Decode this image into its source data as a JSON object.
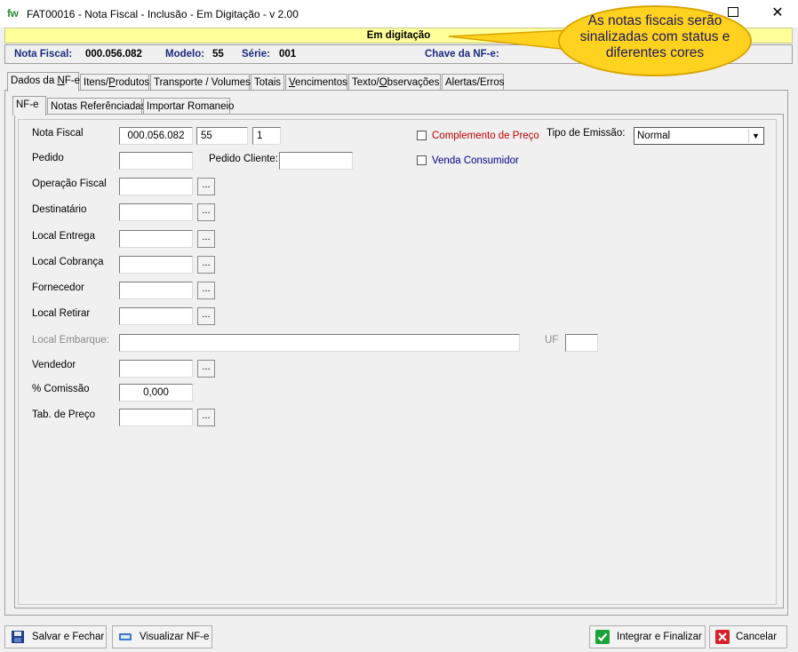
{
  "window": {
    "logo": "fw",
    "title": "FAT00016 - Nota Fiscal - Inclusão - Em Digitação - v 2.00",
    "close_glyph": "✕"
  },
  "status": {
    "text": "Em digitação",
    "color": "#ffff99"
  },
  "callout": {
    "text": "As notas fiscais serão sinalizadas com status e diferentes cores",
    "color": "#ffd21f"
  },
  "infobar": {
    "nota_label": "Nota Fiscal:",
    "nota_value": "000.056.082",
    "modelo_label": "Modelo:",
    "modelo_value": "55",
    "serie_label": "Série:",
    "serie_value": "001",
    "chave_label": "Chave da NF-e:"
  },
  "tabs": [
    "Dados da NF-e",
    "Itens/Produtos",
    "Transporte / Volumes",
    "Totais",
    "Vencimentos",
    "Texto/Observações",
    "Alertas/Erros"
  ],
  "subtabs": [
    "NF-e",
    "Notas Referênciadas",
    "Importar Romaneio"
  ],
  "form": {
    "nota_fiscal_label": "Nota Fiscal",
    "nota_fiscal_number": "000.056.082",
    "nota_fiscal_modelo": "55",
    "nota_fiscal_serie": "1",
    "pedido_label": "Pedido",
    "pedido_cliente_label": "Pedido Cliente:",
    "operacao_fiscal_label": "Operação Fiscal",
    "destinatario_label": "Destinatário",
    "local_entrega_label": "Local Entrega",
    "local_cobranca_label": "Local Cobrança",
    "fornecedor_label": "Fornecedor",
    "local_retirar_label": "Local Retirar",
    "local_embarque_label": "Local Embarque:",
    "uf_label": "UF",
    "vendedor_label": "Vendedor",
    "comissao_label": "% Comissão",
    "comissao_value": "0,000",
    "tab_preco_label": "Tab. de Preço",
    "lookup_glyph": "...",
    "complemento_preco_label": "Complemento de Preço",
    "complemento_preco_color": "#c00000",
    "venda_consumidor_label": "Venda Consumidor",
    "venda_consumidor_color": "#00008b",
    "tipo_emissao_label": "Tipo de Emissão:",
    "tipo_emissao_value": "Normal"
  },
  "buttons": {
    "salvar": "Salvar e Fechar",
    "visualizar": "Visualizar NF-e",
    "integrar": "Integrar e Finalizar",
    "cancelar": "Cancelar"
  }
}
